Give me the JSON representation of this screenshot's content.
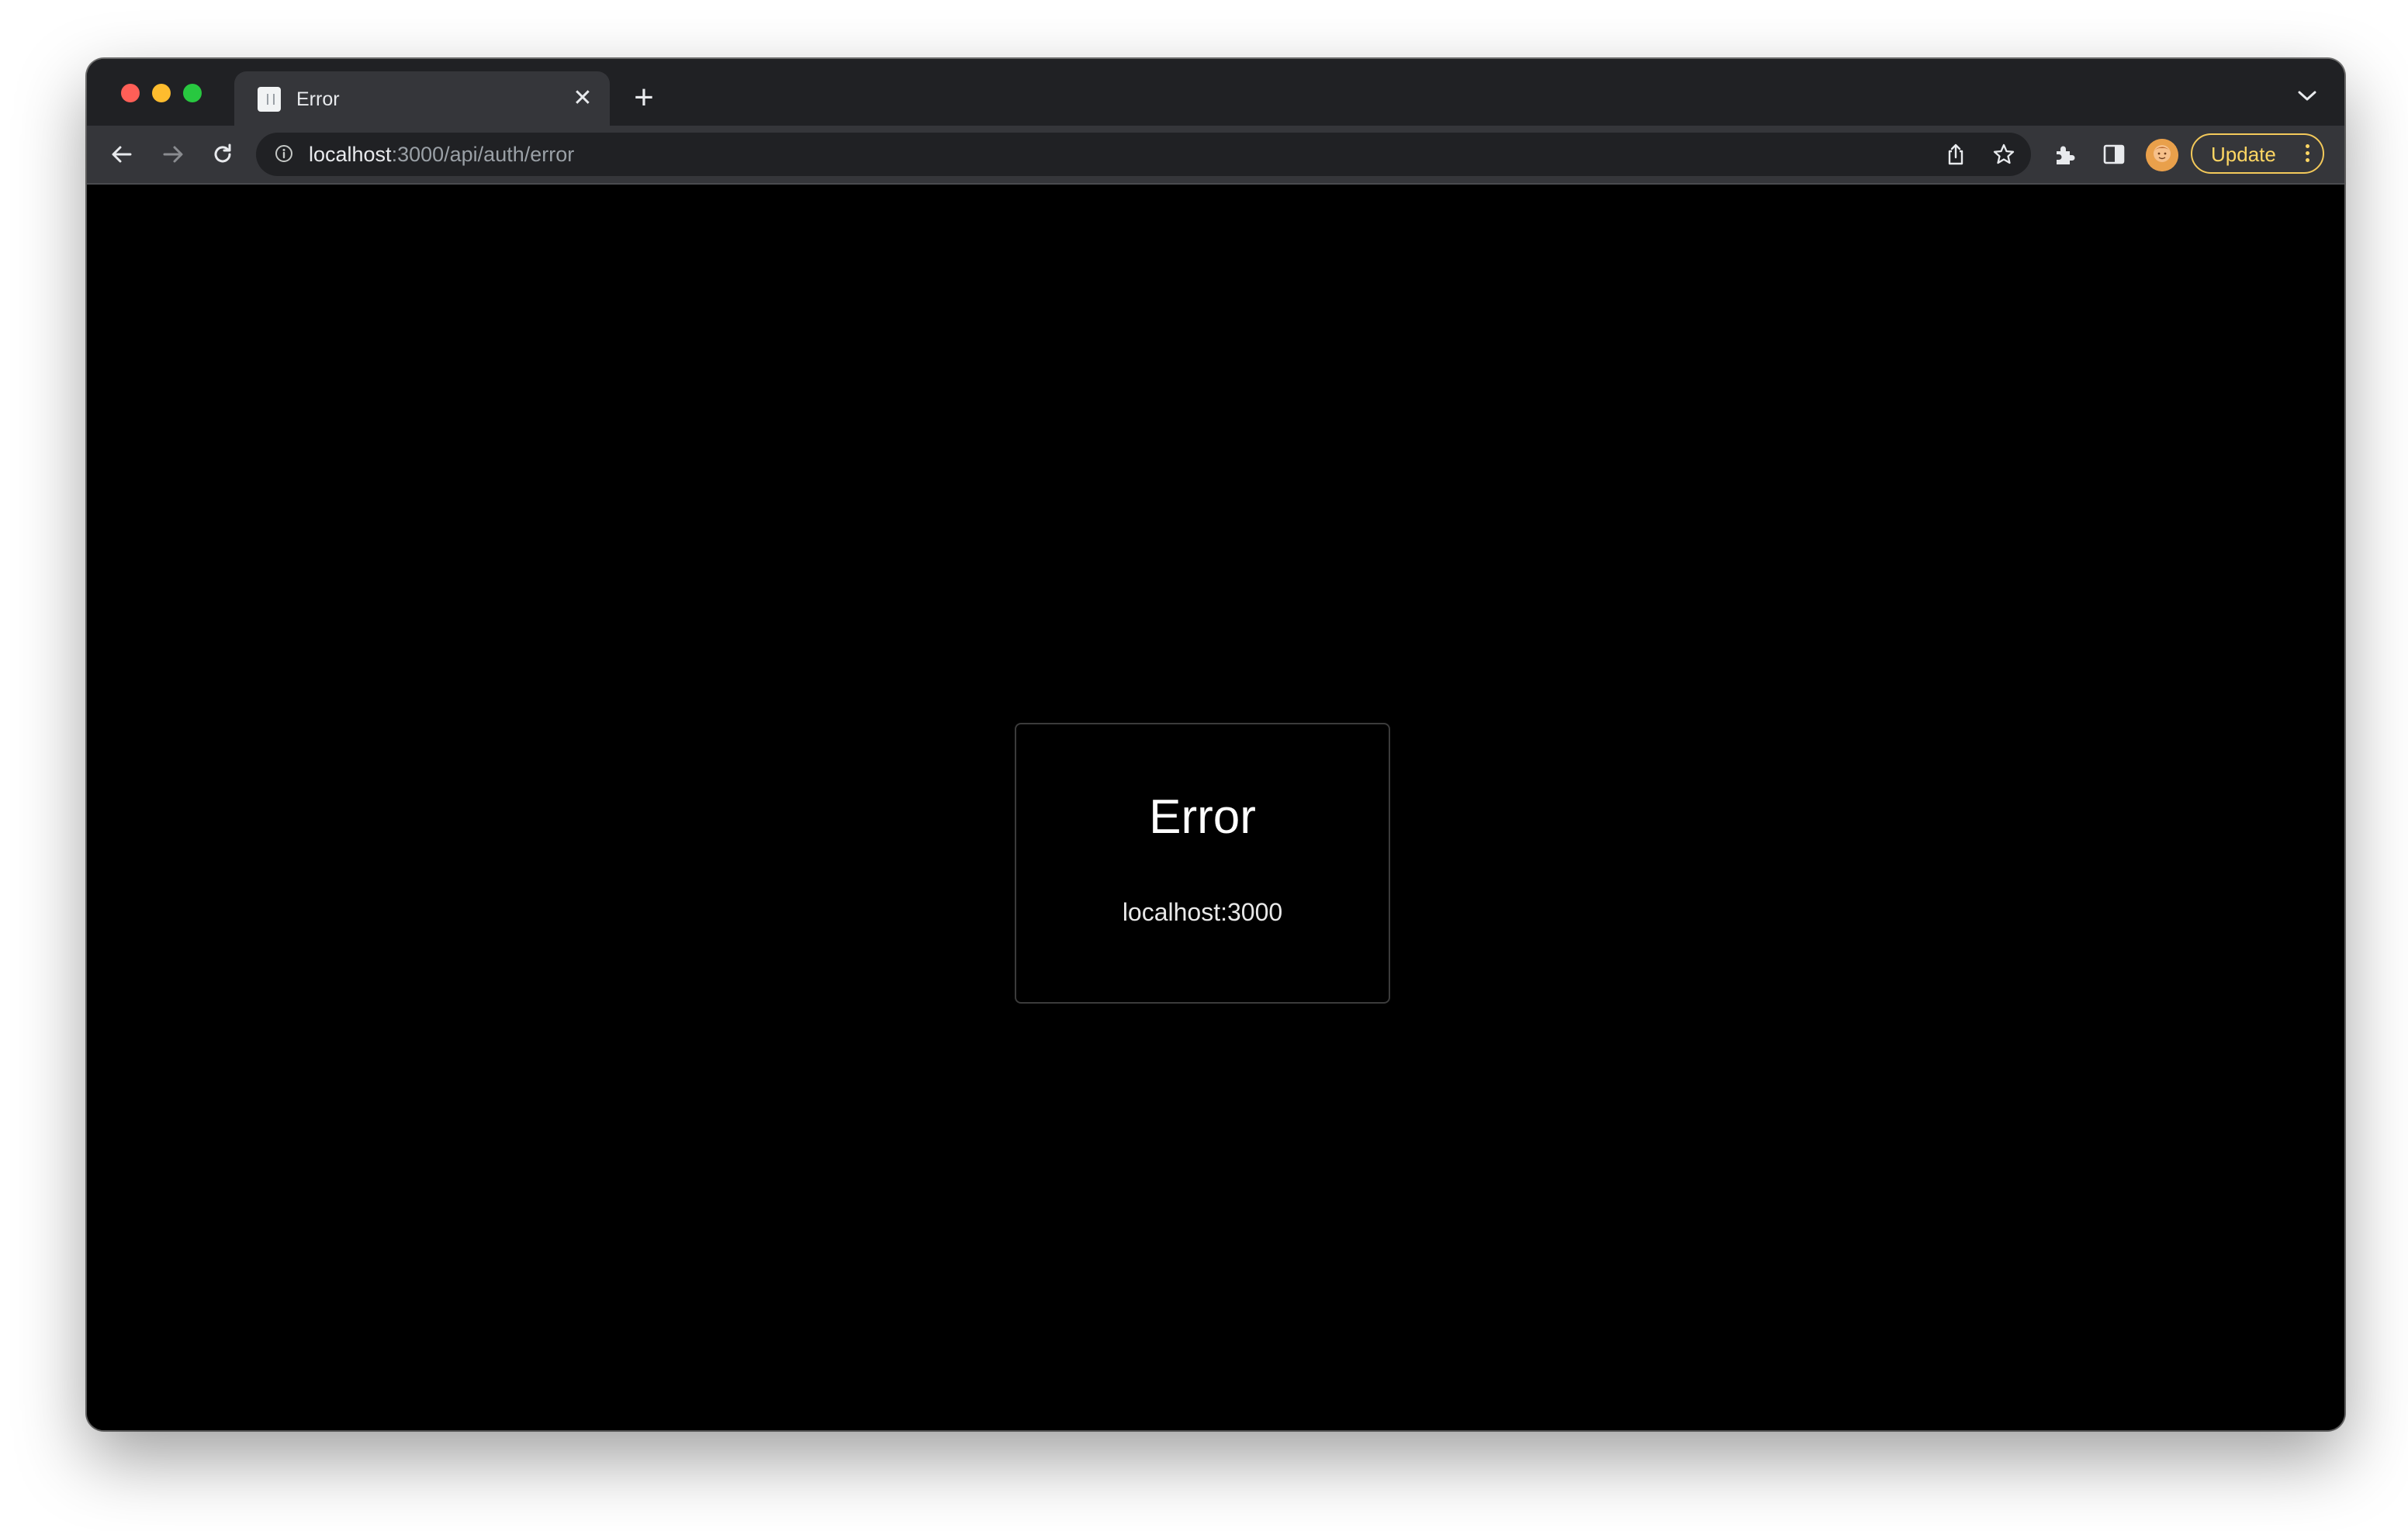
{
  "browser": {
    "tab": {
      "title": "Error"
    },
    "address_bar": {
      "host": "localhost",
      "path": ":3000/api/auth/error"
    },
    "update_button": {
      "label": "Update"
    },
    "icons": [
      "back-arrow-icon",
      "forward-arrow-icon",
      "reload-icon",
      "info-icon",
      "share-icon",
      "star-icon",
      "extensions-icon",
      "side-panel-icon",
      "avatar",
      "kebab-menu-icon"
    ],
    "colors": {
      "update_accent": "#fdd663",
      "close_light": "#ff5f57",
      "minimize_light": "#febc2e",
      "maximize_light": "#28c840"
    }
  },
  "page": {
    "error_card": {
      "title": "Error",
      "message": "localhost:3000"
    }
  }
}
